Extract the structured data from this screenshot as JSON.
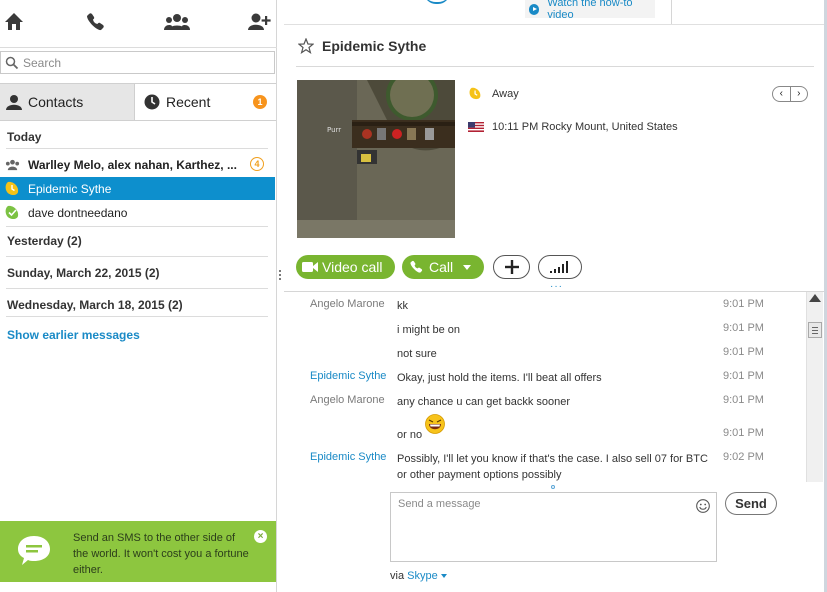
{
  "colors": {
    "accent_blue": "#0d8fcd",
    "call_green": "#79b530",
    "promo_green": "#8dc63f",
    "away_yellow": "#f5c218",
    "online_green": "#7cc243",
    "badge_orange": "#f7941d"
  },
  "nav": {
    "icons": [
      "home-icon",
      "phone-icon",
      "group-icon",
      "add-contact-icon"
    ]
  },
  "search": {
    "placeholder": "Search"
  },
  "tabs": {
    "contacts": "Contacts",
    "recent": "Recent",
    "recent_badge": "1"
  },
  "recent": {
    "today": "Today",
    "group_name": "Warlley Melo, alex nahan, Karthez, ...",
    "group_badge": "4",
    "items": [
      {
        "name": "Epidemic Sythe",
        "status": "away",
        "selected": true
      },
      {
        "name": "dave dontneedano",
        "status": "online",
        "selected": false
      }
    ],
    "yesterday": "Yesterday (2)",
    "sunday": "Sunday, March 22, 2015 (2)",
    "wednesday": "Wednesday, March 18, 2015 (2)",
    "show_earlier": "Show earlier messages"
  },
  "promo": {
    "text": "Send an SMS to the other side of the world. It won't cost you a fortune either."
  },
  "header": {
    "howto": "Watch the how-to video",
    "contact_name": "Epidemic Sythe"
  },
  "profile": {
    "status": "Away",
    "local_time": "10:11 PM Rocky Mount, United States",
    "pager_prev": "‹",
    "pager_next": "›"
  },
  "actions": {
    "video_call": "Video call",
    "call": "Call"
  },
  "messages": [
    {
      "sender": "Angelo Marone",
      "sender_color": "gray",
      "text": "kk",
      "time": "9:01 PM"
    },
    {
      "sender": "",
      "sender_color": "gray",
      "text": "i might be on",
      "time": "9:01 PM"
    },
    {
      "sender": "",
      "sender_color": "gray",
      "text": "not sure",
      "time": "9:01 PM"
    },
    {
      "sender": "Epidemic Sythe",
      "sender_color": "blue",
      "text": "Okay, just hold the items. I'll beat all offers",
      "time": "9:01 PM"
    },
    {
      "sender": "Angelo Marone",
      "sender_color": "gray",
      "text": "any chance u can get backk sooner",
      "time": "9:01 PM"
    },
    {
      "sender": "",
      "sender_color": "gray",
      "text": "or no",
      "time": "9:01 PM",
      "emoticon": "laughing-emoticon"
    },
    {
      "sender": "Epidemic Sythe",
      "sender_color": "blue",
      "text": "Possibly, I'll let you know if that's the case. I also sell 07 for BTC or other payment options possibly",
      "time": "9:02 PM"
    }
  ],
  "compose": {
    "placeholder": "Send a message",
    "send": "Send",
    "via": "via",
    "via_service": "Skype"
  }
}
